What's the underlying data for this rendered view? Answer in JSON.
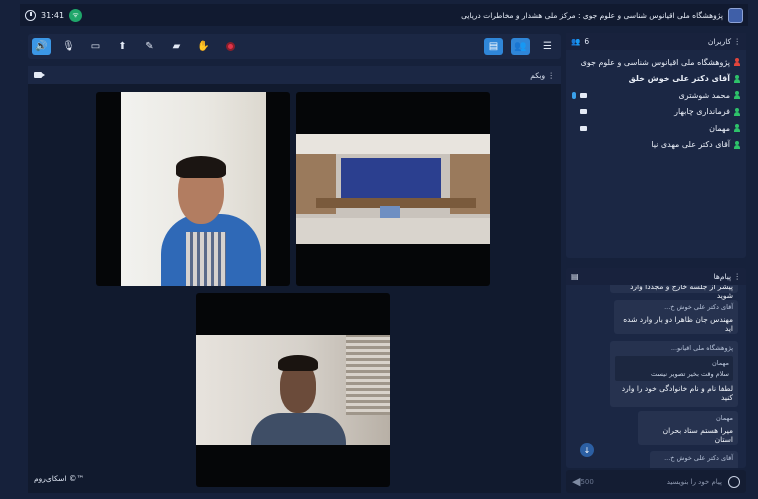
{
  "titlebar": {
    "time": "31:41",
    "title": "پژوهشگاه ملی اقیانوس شناسی و علوم جوی : مرکز ملی هشدار و مخاطرات دریایی"
  },
  "toolbar": {
    "icons": [
      "speaker-icon",
      "mic-off-icon",
      "camera-off-icon",
      "share-screen-icon",
      "brush-icon",
      "folder-icon",
      "raise-hand-icon",
      "record-icon"
    ]
  },
  "webcam": {
    "title": "وبکم",
    "watermark": "اسکای‌روم ©™"
  },
  "users": {
    "title": "کاربران",
    "count": "6",
    "list": [
      {
        "name": "پژوهشگاه ملی اقیانوس شناسی و علوم جوی",
        "color": "#e2453c"
      },
      {
        "name": "آقای دکتر علی خوش خلق",
        "color": "#2ec26a"
      },
      {
        "name": "محمد شوشتری",
        "color": "#2ec26a"
      },
      {
        "name": "فرمانداری چابهار",
        "color": "#2ec26a"
      },
      {
        "name": "مهمان",
        "color": "#2ec26a"
      },
      {
        "name": "آقای دکتر علی مهدی نیا",
        "color": "#2ec26a"
      }
    ]
  },
  "messages": {
    "title": "پیام‌ها",
    "items": [
      {
        "who": "",
        "text": "پیشر از جلسه خارج و مجددا وارد شوید"
      },
      {
        "who": "آقای دکتر علی خوش خ...",
        "text": "مهندس جان ظاهرا دو بار وارد شده اید"
      },
      {
        "who": "پژوهشگاه ملی اقیانو...",
        "quote_who": "مهمان",
        "quote": "سلام وقت بخیر تصویر نیست",
        "text": "لطفا نام و نام خانوادگی خود را وارد کنید"
      },
      {
        "who": "مهمان",
        "text": "میرا هستم ستاد بحران استان"
      },
      {
        "who": "آقای دکتر علی خوش خ...",
        "text": ""
      }
    ]
  },
  "composer": {
    "placeholder": "پیام خود را بنویسید",
    "counter": "500"
  }
}
